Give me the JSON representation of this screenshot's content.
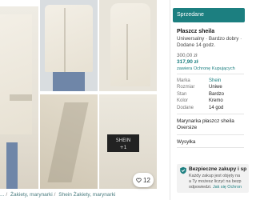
{
  "gallery": {
    "tag_label": "SHEIN\n+1",
    "like_count": "12"
  },
  "breadcrumbs": [
    "...",
    "Żakiety, marynarki",
    "Shein Żakiety, marynarki"
  ],
  "item": {
    "status": "Sprzedane",
    "title": "Płaszcz sheila",
    "subtitle": "Uniwersalny · Bardzo dobry ·",
    "posted": "Dodane 14 godz.",
    "old_price": "300,00 zł",
    "new_price": "317,90 zł",
    "protection": "zawiera Ochronę Kupujących"
  },
  "details": [
    {
      "key": "Marka",
      "value": "Shein"
    },
    {
      "key": "Rozmiar",
      "value": "Uniwe"
    },
    {
      "key": "Stan",
      "value": "Bardzo"
    },
    {
      "key": "Kolor",
      "value": "Kremo"
    },
    {
      "key": "Dodane",
      "value": "14 god"
    }
  ],
  "description": [
    "Marynarka płaszcz sheila",
    "Oversize"
  ],
  "shipping_label": "Wysyłka",
  "safe_box": {
    "title": "Bezpieczne zakupy i sp",
    "line1": "Każdy zakup jest objęty na",
    "line2": "a Ty możesz liczyć na bezp",
    "line3_prefix": "odpowiedzi.",
    "link": "Jak się Ochron"
  },
  "colors": {
    "accent": "#1c7f80",
    "link": "#4a7c7f"
  }
}
